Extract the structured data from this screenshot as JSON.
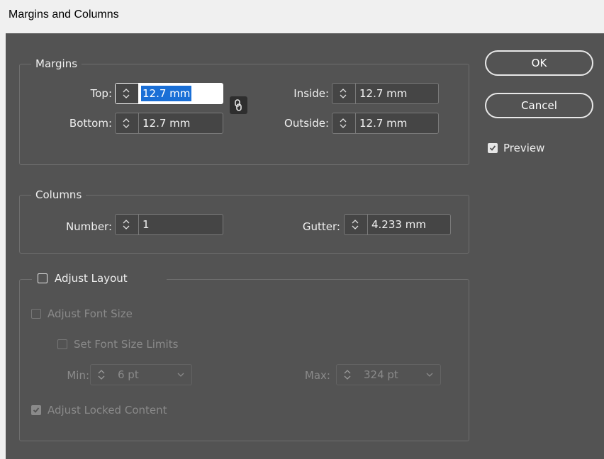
{
  "window": {
    "title": "Margins and Columns"
  },
  "margins": {
    "legend": "Margins",
    "top": {
      "label": "Top:",
      "value": "12.7 mm"
    },
    "bottom": {
      "label": "Bottom:",
      "value": "12.7 mm"
    },
    "inside": {
      "label": "Inside:",
      "value": "12.7 mm"
    },
    "outside": {
      "label": "Outside:",
      "value": "12.7 mm"
    },
    "link_icon": "chain-link-icon"
  },
  "columns": {
    "legend": "Columns",
    "number": {
      "label": "Number:",
      "value": "1"
    },
    "gutter": {
      "label": "Gutter:",
      "value": "4.233 mm"
    }
  },
  "adjust_layout": {
    "label": "Adjust Layout",
    "checked": false,
    "adjust_font_size": {
      "label": "Adjust Font Size",
      "checked": false
    },
    "set_font_size_limits": {
      "label": "Set Font Size Limits",
      "checked": false
    },
    "min": {
      "label": "Min:",
      "value": "6 pt"
    },
    "max": {
      "label": "Max:",
      "value": "324 pt"
    },
    "adjust_locked_content": {
      "label": "Adjust Locked Content",
      "checked": true
    }
  },
  "buttons": {
    "ok": "OK",
    "cancel": "Cancel"
  },
  "preview": {
    "label": "Preview",
    "checked": true
  },
  "colors": {
    "dialog_bg": "#535353",
    "field_bg": "#454545",
    "selection": "#1a6fd6",
    "text": "#f0f0f0",
    "disabled_text": "#8a8a8a"
  }
}
